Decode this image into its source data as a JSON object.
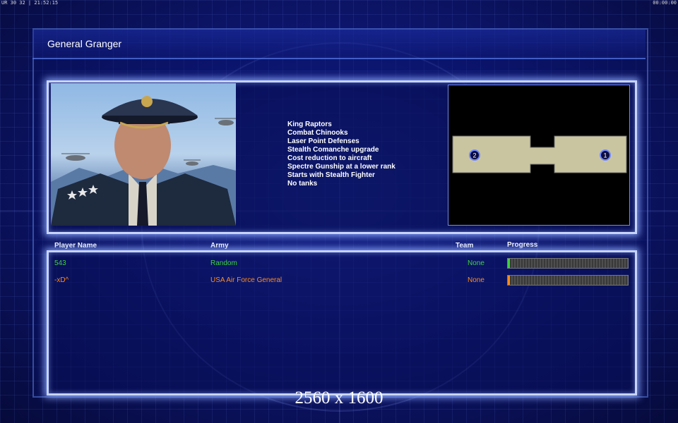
{
  "top_bar": {
    "left_text": "UR 30 32 | 21:52:15",
    "right_text": "00:00:00"
  },
  "screen_title": "General Granger",
  "general": {
    "portrait": "general-granger-portrait",
    "features": [
      "King Raptors",
      "Combat Chinooks",
      "Laser Point Defenses",
      "Stealth Comanche upgrade",
      "Cost reduction to aircraft",
      "Spectre Gunship at a lower rank",
      "Starts with Stealth Fighter",
      "No tanks"
    ]
  },
  "minimap": {
    "start_positions": [
      "2",
      "1"
    ]
  },
  "columns": {
    "player_name": "Player Name",
    "army": "Army",
    "team": "Team",
    "progress": "Progress"
  },
  "players": [
    {
      "name": "543",
      "army": "Random",
      "team": "None",
      "progress": 0.01,
      "color": "#3fd23f"
    },
    {
      "name": "-xD^",
      "army": "USA Air Force General",
      "team": "None",
      "progress": 0.02,
      "color": "#ff8c1a"
    }
  ],
  "watermark": "2560 x 1600",
  "colors": {
    "background": "#0d1670",
    "box_glow": "#c8d4ff",
    "player1": "#3fd23f",
    "player2": "#ff8c1a"
  }
}
